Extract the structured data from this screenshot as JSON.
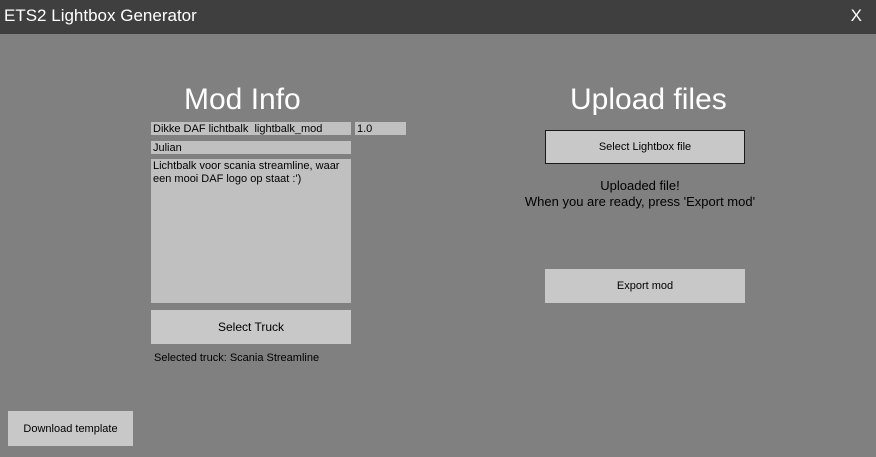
{
  "window": {
    "title": "ETS2 Lightbox Generator",
    "close_label": "X"
  },
  "mod_info": {
    "heading": "Mod Info",
    "name_value": "Dikke DAF lichtbalk  lightbalk_mod",
    "version_value": "1.0",
    "author_value": "Julian",
    "description_value": "Lichtbalk voor scania streamline, waar een mooi DAF logo op staat :')",
    "select_truck_label": "Select Truck",
    "selected_truck_text": "Selected truck: Scania Streamline"
  },
  "upload": {
    "heading": "Upload files",
    "select_file_label": "Select Lightbox file",
    "status_line1": "Uploaded file!",
    "status_line2": "When you are ready, press 'Export mod'",
    "export_label": "Export mod"
  },
  "footer": {
    "download_template_label": "Download template"
  },
  "colors": {
    "background": "#808080",
    "titlebar": "#3f3f3f",
    "field": "#c0c0c0",
    "button": "#c8c8c8"
  }
}
